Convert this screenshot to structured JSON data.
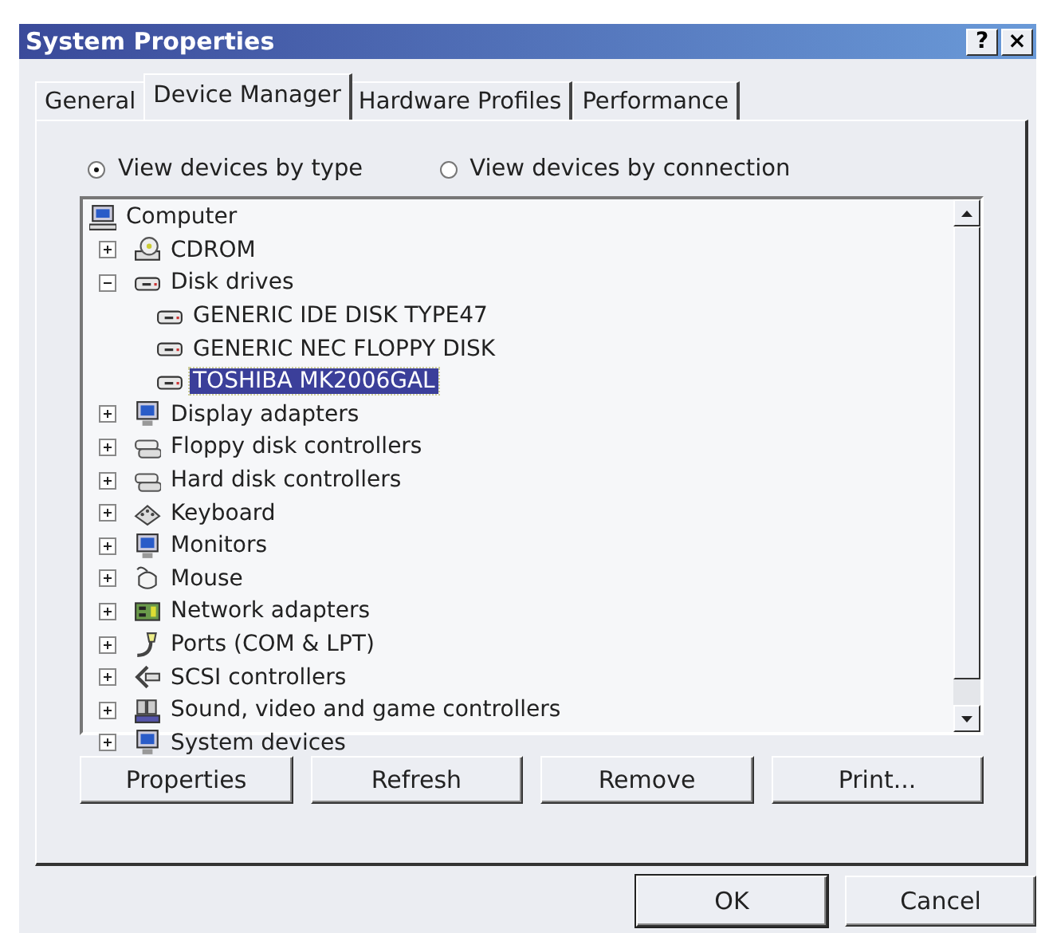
{
  "window": {
    "title": "System Properties",
    "title_buttons": [
      "?",
      "×"
    ]
  },
  "tabs": [
    {
      "label": "General",
      "selected": false
    },
    {
      "label": "Device Manager",
      "selected": true
    },
    {
      "label": "Hardware Profiles",
      "selected": false
    },
    {
      "label": "Performance",
      "selected": false
    }
  ],
  "view_options": [
    {
      "label": "View devices by type",
      "selected": true
    },
    {
      "label": "View devices by connection",
      "selected": false
    }
  ],
  "device_tree": {
    "label": "Computer",
    "children": [
      {
        "label": "CDROM",
        "expanded": false
      },
      {
        "label": "Disk drives",
        "expanded": true,
        "children": [
          {
            "label": "GENERIC IDE  DISK TYPE47",
            "selected": false
          },
          {
            "label": "GENERIC NEC  FLOPPY DISK",
            "selected": false
          },
          {
            "label": "TOSHIBA MK2006GAL",
            "selected": true
          }
        ]
      },
      {
        "label": "Display adapters",
        "expanded": false
      },
      {
        "label": "Floppy disk controllers",
        "expanded": false
      },
      {
        "label": "Hard disk controllers",
        "expanded": false
      },
      {
        "label": "Keyboard",
        "expanded": false
      },
      {
        "label": "Monitors",
        "expanded": false
      },
      {
        "label": "Mouse",
        "expanded": false
      },
      {
        "label": "Network adapters",
        "expanded": false
      },
      {
        "label": "Ports (COM & LPT)",
        "expanded": false
      },
      {
        "label": "SCSI controllers",
        "expanded": false
      },
      {
        "label": "Sound, video and game controllers",
        "expanded": false
      },
      {
        "label": "System devices",
        "expanded": false
      }
    ]
  },
  "device_buttons": [
    "Properties",
    "Refresh",
    "Remove",
    "Print..."
  ],
  "dialog_buttons": [
    "OK",
    "Cancel"
  ]
}
